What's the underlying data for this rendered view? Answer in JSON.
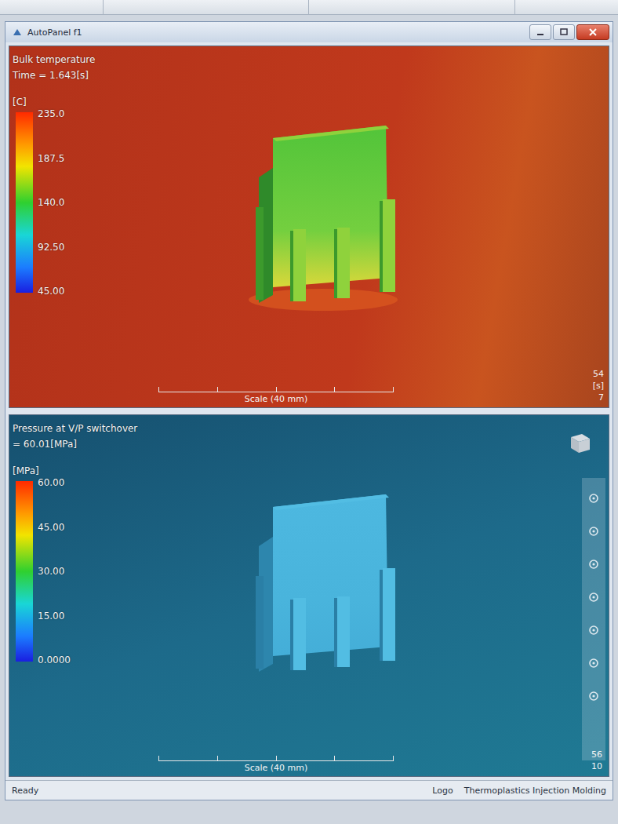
{
  "window": {
    "title": "AutoPanel f1"
  },
  "viewports": [
    {
      "result": "Bulk temperature",
      "value": "Time = 1.643[s]",
      "unit": "[C]",
      "ticks": [
        "235.0",
        "187.5",
        "140.0",
        "92.50",
        "45.00"
      ],
      "scale": "Scale (40 mm)",
      "corner": [
        "54",
        "[s]",
        "7"
      ],
      "navbar": false
    },
    {
      "result": "Pressure at V/P switchover",
      "value": "= 60.01[MPa]",
      "unit": "[MPa]",
      "ticks": [
        "60.00",
        "45.00",
        "30.00",
        "15.00",
        "0.0000"
      ],
      "scale": "Scale (40 mm)",
      "corner": [
        "56",
        "10"
      ],
      "navbar": true
    }
  ],
  "status_bar": {
    "left": "Ready",
    "right": [
      "Logo",
      "Thermoplastics Injection Molding"
    ]
  }
}
